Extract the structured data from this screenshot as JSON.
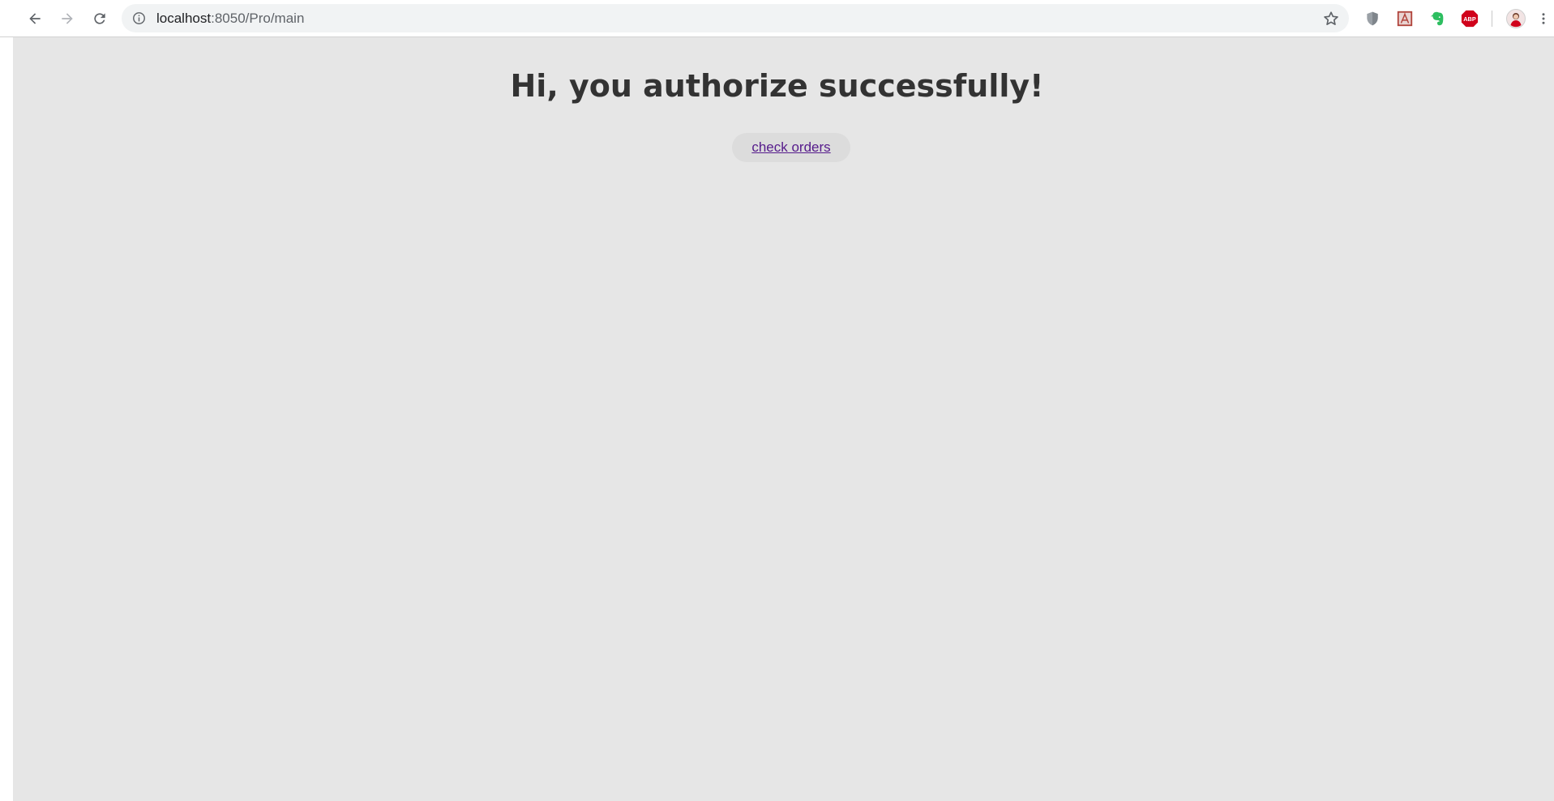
{
  "browser": {
    "url_host": "localhost",
    "url_path": ":8050/Pro/main",
    "icons": [
      "back-arrow-icon",
      "forward-arrow-icon",
      "reload-icon",
      "info-icon",
      "bookmark-star-icon",
      "shield-extension-icon",
      "pdf-extension-icon",
      "evernote-extension-icon",
      "adblock-extension-icon",
      "profile-avatar-icon",
      "menu-kebab-icon"
    ],
    "adblock_label": "ABP"
  },
  "page": {
    "heading": "Hi, you authorize successfully!",
    "orders_link": "check orders",
    "background_color": "#e6e6e6",
    "link_color": "#551a8b"
  }
}
